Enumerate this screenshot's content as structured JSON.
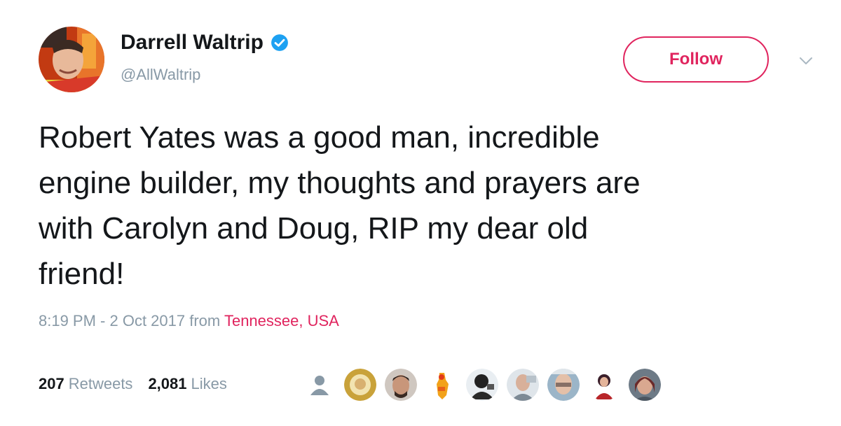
{
  "author": {
    "name": "Darrell Waltrip",
    "handle": "@AllWaltrip",
    "verified": true,
    "avatar_icon": "avatar-photo"
  },
  "follow_label": "Follow",
  "tweet": {
    "text": "Robert Yates was a good man, incredible\nengine builder, my thoughts and prayers are\nwith Carolyn and Doug, RIP my dear old\nfriend!"
  },
  "meta": {
    "time": "8:19 PM - 2 Oct 2017",
    "from": "from",
    "location": "Tennessee, USA"
  },
  "stats": {
    "retweets_count": "207",
    "retweets_label": "Retweets",
    "likes_count": "2,081",
    "likes_label": "Likes"
  },
  "colors": {
    "accent": "#e0245e",
    "verified": "#1da1f2",
    "muted": "#8899a6",
    "text": "#14171a"
  }
}
